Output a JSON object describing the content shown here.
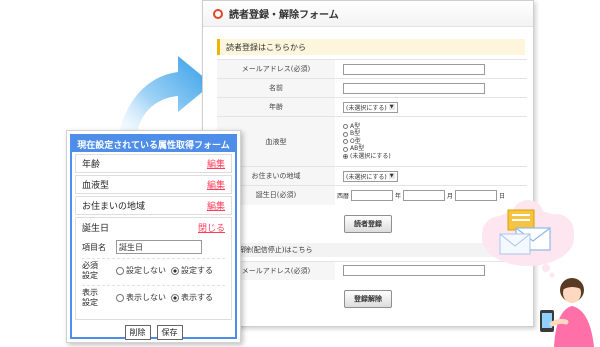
{
  "form": {
    "title": "読者登録・解除フォーム",
    "register_section": "読者登録はこちらから",
    "rows": [
      {
        "label": "メールアドレス(必須)"
      },
      {
        "label": "名前"
      },
      {
        "label": "年齢",
        "select": "(未選択にする)"
      },
      {
        "label": "血液型",
        "options": [
          "A型",
          "B型",
          "O型",
          "AB型",
          "(未選択にする)"
        ],
        "selected": 4
      },
      {
        "label": "お住まいの地域",
        "select": "(未選択にする)"
      },
      {
        "label": "誕生日(必須)",
        "date": [
          "西暦",
          "年",
          "月",
          "日"
        ]
      }
    ],
    "register_button": "読者登録",
    "unsubscribe_section": "録の解除(配信停止)はこちら",
    "unsub_email_label": "メールアドレス(必須)",
    "unsubscribe_button": "登録解除"
  },
  "attr_panel": {
    "title": "現在設定されている属性取得フォーム",
    "items": [
      {
        "label": "年齢",
        "action": "編集"
      },
      {
        "label": "血液型",
        "action": "編集"
      },
      {
        "label": "お住まいの地域",
        "action": "編集"
      }
    ],
    "open_item": {
      "label": "誕生日",
      "action": "閉じる",
      "name_label": "項目名",
      "name_value": "誕生日",
      "required_label_1": "必須",
      "required_label_2": "設定",
      "required_options": [
        "設定しない",
        "設定する"
      ],
      "required_selected": 1,
      "display_label_1": "表示",
      "display_label_2": "設定",
      "display_options": [
        "表示しない",
        "表示する"
      ],
      "display_selected": 1,
      "delete_button": "削除",
      "save_button": "保存"
    }
  },
  "colors": {
    "accent_blue": "#4f8ee8",
    "link_red": "#ff3d5a",
    "title_ring": "#e0462a",
    "section_bar": "#f0b400",
    "arrow_blue": "#3aa3e8"
  }
}
